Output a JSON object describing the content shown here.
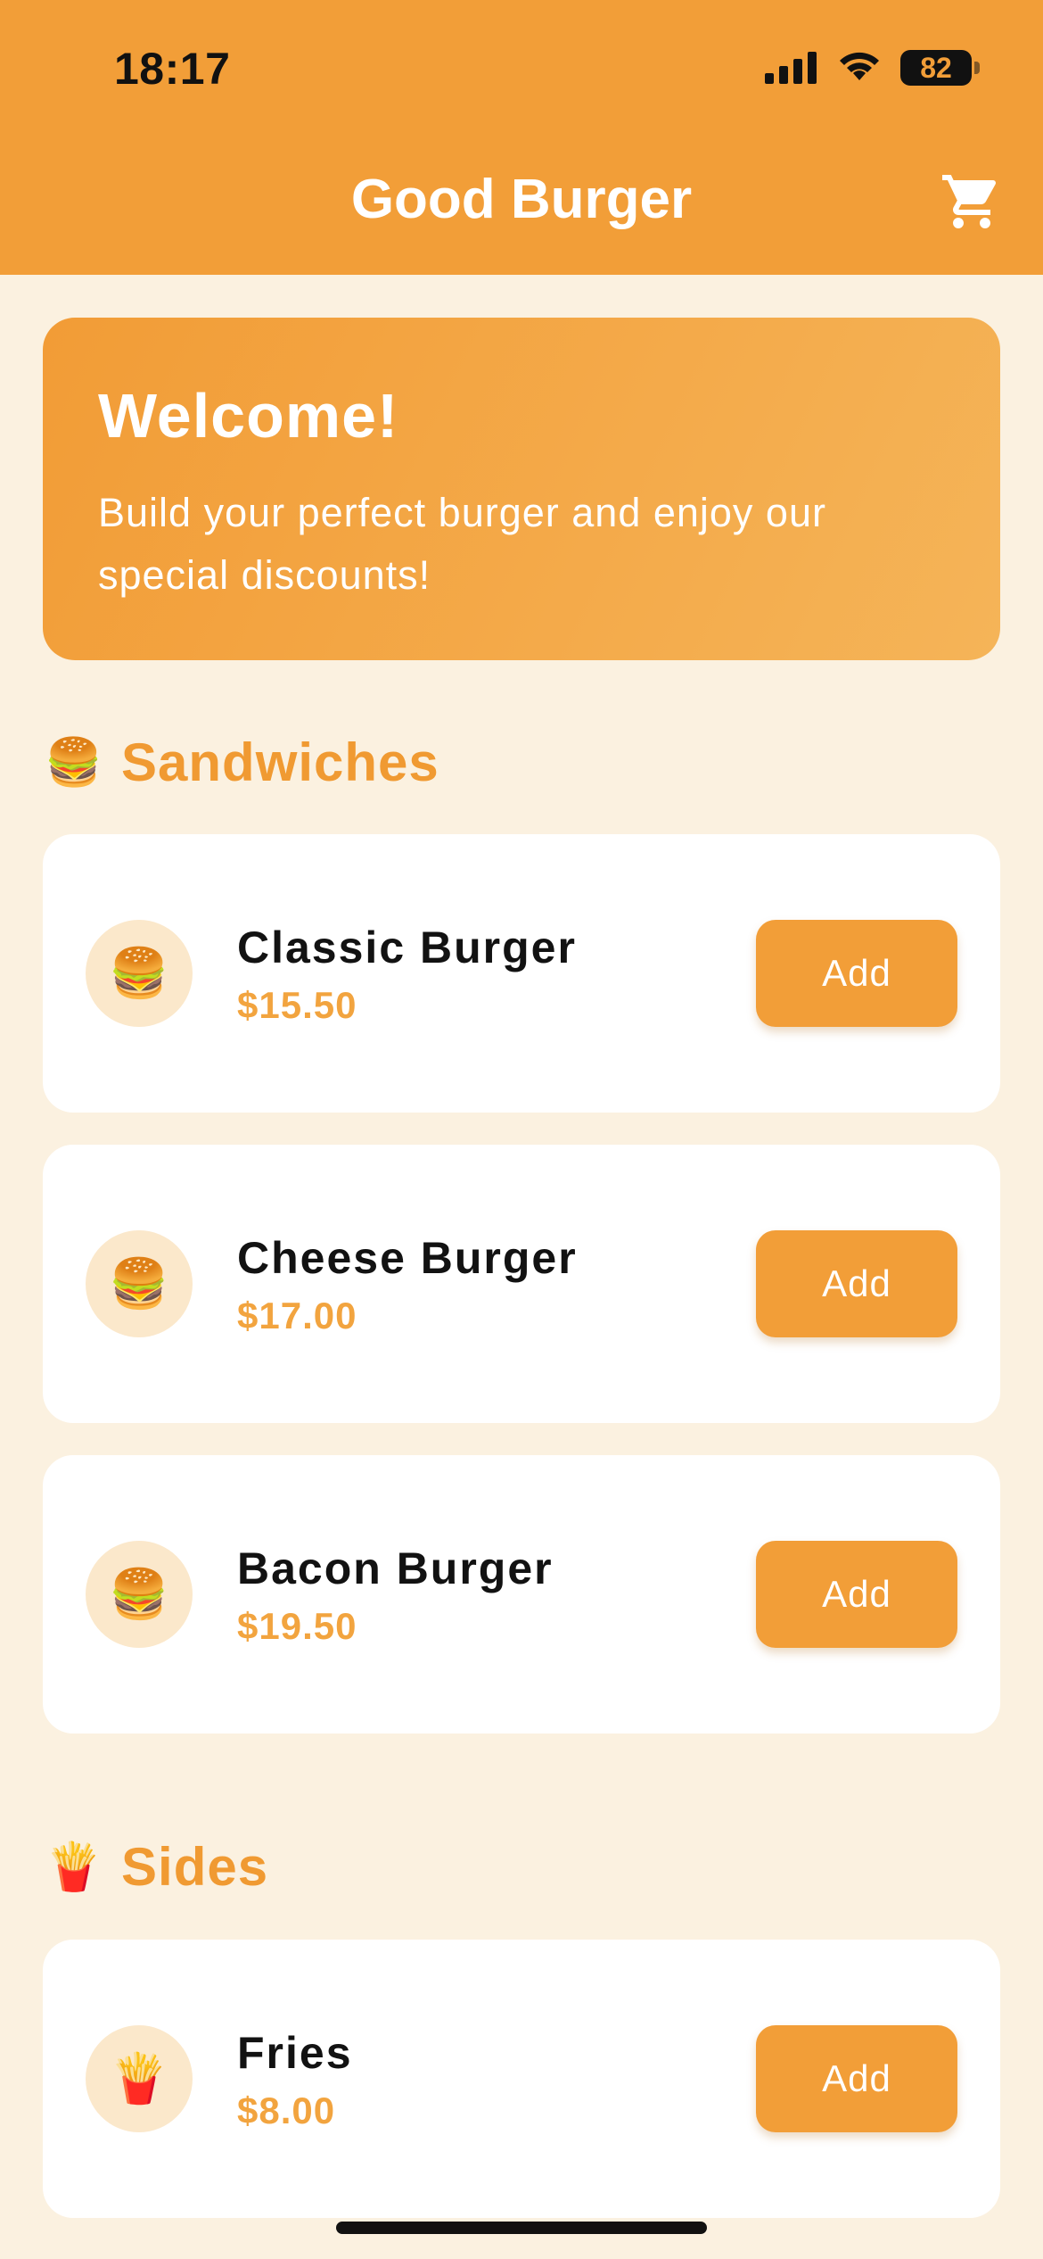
{
  "status_bar": {
    "time": "18:17",
    "battery": "82",
    "icons": [
      "signal-icon",
      "wifi-icon",
      "battery-icon"
    ]
  },
  "header": {
    "title": "Good Burger",
    "cart_icon": "cart-icon"
  },
  "welcome": {
    "title": "Welcome!",
    "subtitle": "Build your perfect burger and enjoy our special discounts!"
  },
  "sections": [
    {
      "emoji": "🍔",
      "title": "Sandwiches",
      "items": [
        {
          "emoji": "🍔",
          "name": "Classic Burger",
          "price": "$15.50",
          "button": "Add"
        },
        {
          "emoji": "🍔",
          "name": "Cheese Burger",
          "price": "$17.00",
          "button": "Add"
        },
        {
          "emoji": "🍔",
          "name": "Bacon Burger",
          "price": "$19.50",
          "button": "Add"
        }
      ]
    },
    {
      "emoji": "🍟",
      "title": "Sides",
      "items": [
        {
          "emoji": "🍟",
          "name": "Fries",
          "price": "$8.00",
          "button": "Add"
        }
      ]
    }
  ],
  "colors": {
    "accent": "#f29e38",
    "background": "#fbf1e0",
    "price": "#f2a43f",
    "thumb_bg": "#fbe8cb"
  }
}
